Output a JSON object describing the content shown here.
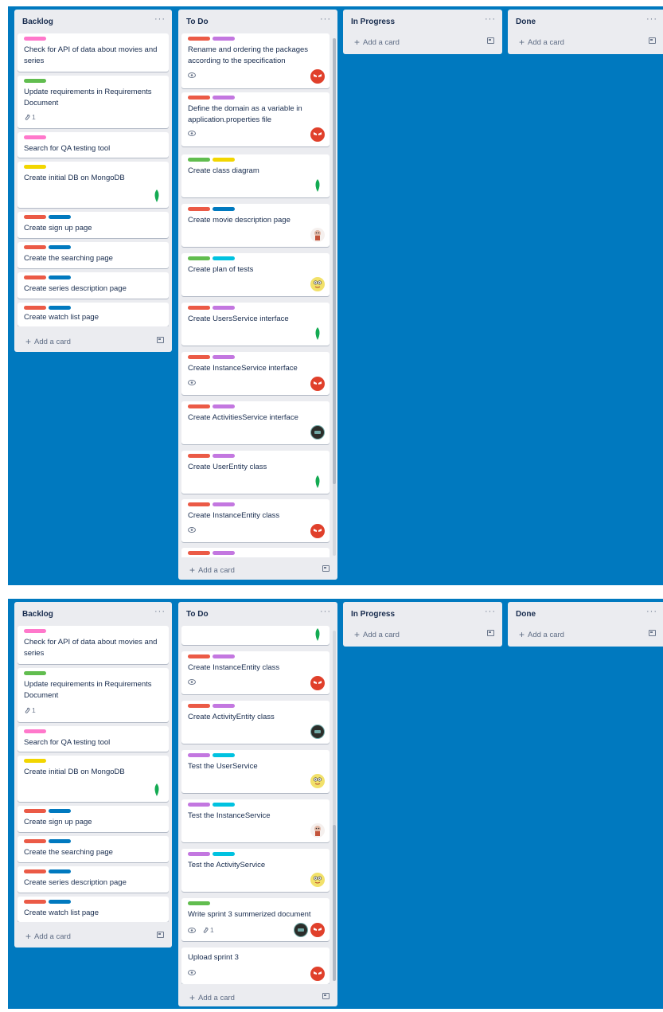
{
  "colors": {
    "board_bg": "#0079bf",
    "list_bg": "#ebecf0",
    "red": "#eb5a46",
    "blue": "#0079bf",
    "purple": "#c377e0",
    "green": "#61bd4f",
    "yellow": "#f2d600",
    "pink": "#ff78cb",
    "sky": "#00c2e0"
  },
  "common": {
    "menu": "···",
    "add_card": "Add a card",
    "plus": "+"
  },
  "lists": {
    "backlog": "Backlog",
    "todo": "To Do",
    "in_progress": "In Progress",
    "done": "Done"
  },
  "backlog_cards": [
    {
      "title": "Check for API of data about movies and series",
      "labels": [
        "pink"
      ]
    },
    {
      "title": "Update requirements in Requirements Document",
      "labels": [
        "green"
      ],
      "attachments": "1"
    },
    {
      "title": "Search for QA testing tool",
      "labels": [
        "pink"
      ]
    },
    {
      "title": "Create initial DB on MongoDB",
      "labels": [
        "yellow"
      ],
      "members": [
        "leaf"
      ]
    },
    {
      "title": "Create sign up page",
      "labels": [
        "red",
        "blue"
      ]
    },
    {
      "title": "Create the searching page",
      "labels": [
        "red",
        "blue"
      ]
    },
    {
      "title": "Create series description page",
      "labels": [
        "red",
        "blue"
      ]
    },
    {
      "title": "Create watch list page",
      "labels": [
        "red",
        "blue"
      ]
    }
  ],
  "todo_cards_top": [
    {
      "title": "Rename and ordering the packages according to the specification",
      "labels": [
        "red",
        "purple"
      ],
      "watch": true,
      "members": [
        "red"
      ]
    },
    {
      "title": "Define the domain as a variable in application.properties file",
      "labels": [
        "red",
        "purple"
      ],
      "watch": true,
      "members": [
        "red"
      ]
    },
    {
      "title": "Create class diagram",
      "labels": [
        "green",
        "yellow"
      ],
      "members": [
        "leaf"
      ]
    },
    {
      "title": "Create movie description page",
      "labels": [
        "red",
        "blue"
      ],
      "members": [
        "pink"
      ]
    },
    {
      "title": "Create plan of tests",
      "labels": [
        "green",
        "sky"
      ],
      "members": [
        "yellow"
      ]
    },
    {
      "title": "Create UsersService interface",
      "labels": [
        "red",
        "purple"
      ],
      "members": [
        "leaf"
      ]
    },
    {
      "title": "Create InstanceService interface",
      "labels": [
        "red",
        "purple"
      ],
      "watch": true,
      "members": [
        "red"
      ]
    },
    {
      "title": "Create ActivitiesService interface",
      "labels": [
        "red",
        "purple"
      ],
      "members": [
        "dark"
      ]
    },
    {
      "title": "Create UserEntity class",
      "labels": [
        "red",
        "purple"
      ],
      "members": [
        "leaf"
      ]
    },
    {
      "title": "Create InstanceEntity class",
      "labels": [
        "red",
        "purple"
      ],
      "watch": true,
      "members": [
        "red"
      ]
    },
    {
      "title": "",
      "labels": [
        "red",
        "purple"
      ]
    }
  ],
  "todo_cards_bottom": [
    {
      "title": "",
      "labels": [],
      "members": [
        "leaf"
      ]
    },
    {
      "title": "Create InstanceEntity class",
      "labels": [
        "red",
        "purple"
      ],
      "watch": true,
      "members": [
        "red"
      ]
    },
    {
      "title": "Create ActivityEntity class",
      "labels": [
        "red",
        "purple"
      ],
      "members": [
        "dark"
      ]
    },
    {
      "title": "Test the UserService",
      "labels": [
        "purple",
        "sky"
      ],
      "members": [
        "yellow"
      ]
    },
    {
      "title": "Test the InstanceService",
      "labels": [
        "purple",
        "sky"
      ],
      "members": [
        "pink"
      ]
    },
    {
      "title": "Test the ActivityService",
      "labels": [
        "purple",
        "sky"
      ],
      "members": [
        "yellow"
      ]
    },
    {
      "title": "Write sprint 3 summerized document",
      "labels": [
        "green"
      ],
      "watch": true,
      "attachments": "1",
      "members": [
        "dark",
        "red"
      ]
    },
    {
      "title": "Upload sprint 3",
      "labels": [],
      "watch": true,
      "members": [
        "red"
      ]
    }
  ]
}
